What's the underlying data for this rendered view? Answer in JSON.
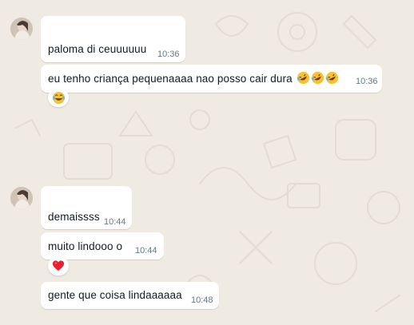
{
  "chat": {
    "group1": {
      "avatar_icon": "profile-photo-icon",
      "messages": [
        {
          "text": "paloma di ceuuuuuu",
          "time": "10:36"
        },
        {
          "text": "eu tenho criança pequenaaaa nao posso cair dura",
          "time": "10:36",
          "emojis": [
            "rolling-laughing-icon",
            "rolling-laughing-icon",
            "rolling-laughing-icon"
          ],
          "reaction": "tears-of-joy-icon"
        }
      ]
    },
    "group2": {
      "avatar_icon": "profile-photo-icon",
      "messages": [
        {
          "text": "demaissss",
          "time": "10:44"
        },
        {
          "text": "muito lindooo o",
          "time": "10:44",
          "reaction": "red-heart-icon"
        },
        {
          "text": "gente que coisa lindaaaaaa",
          "time": "10:48"
        }
      ]
    }
  },
  "colors": {
    "background": "#efeae2",
    "bubble": "#ffffff",
    "text": "#111b21",
    "timestamp": "#667781"
  }
}
